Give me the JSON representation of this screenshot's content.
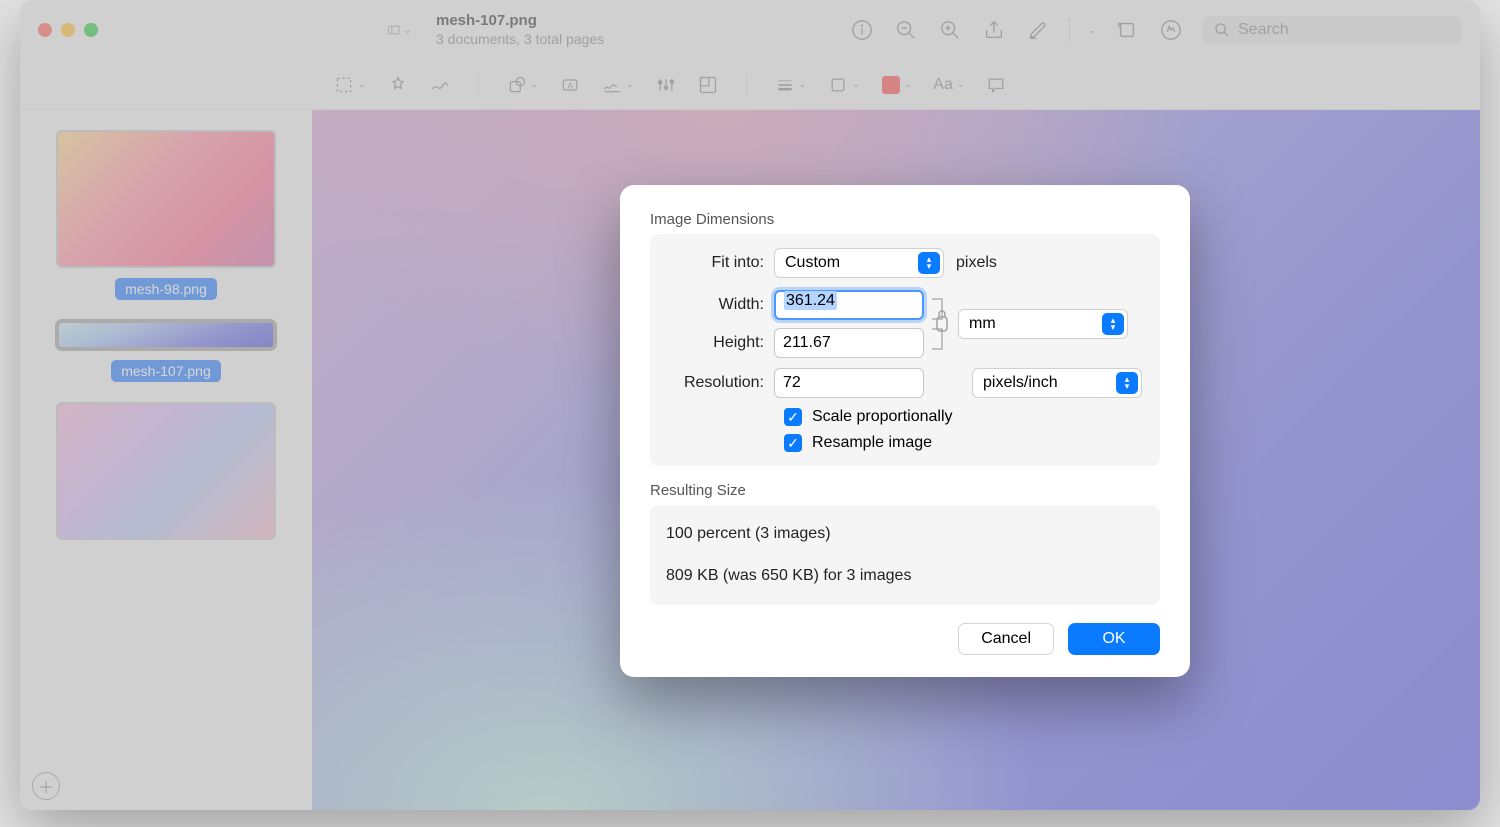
{
  "window": {
    "title": "mesh-107.png",
    "subtitle": "3 documents, 3 total pages",
    "search_placeholder": "Search"
  },
  "sidebar": {
    "thumbs": [
      {
        "label": "mesh-98.png"
      },
      {
        "label": "mesh-107.png"
      },
      {
        "label": ""
      }
    ]
  },
  "dialog": {
    "section1_title": "Image Dimensions",
    "fit_into_label": "Fit into:",
    "fit_into_value": "Custom",
    "fit_into_unit": "pixels",
    "width_label": "Width:",
    "width_value": "361.24",
    "height_label": "Height:",
    "height_value": "211.67",
    "dim_unit": "mm",
    "resolution_label": "Resolution:",
    "resolution_value": "72",
    "resolution_unit": "pixels/inch",
    "scale_label": "Scale proportionally",
    "resample_label": "Resample image",
    "section2_title": "Resulting Size",
    "result_line1": "100 percent (3 images)",
    "result_line2": "809 KB (was 650 KB) for 3 images",
    "cancel": "Cancel",
    "ok": "OK"
  }
}
